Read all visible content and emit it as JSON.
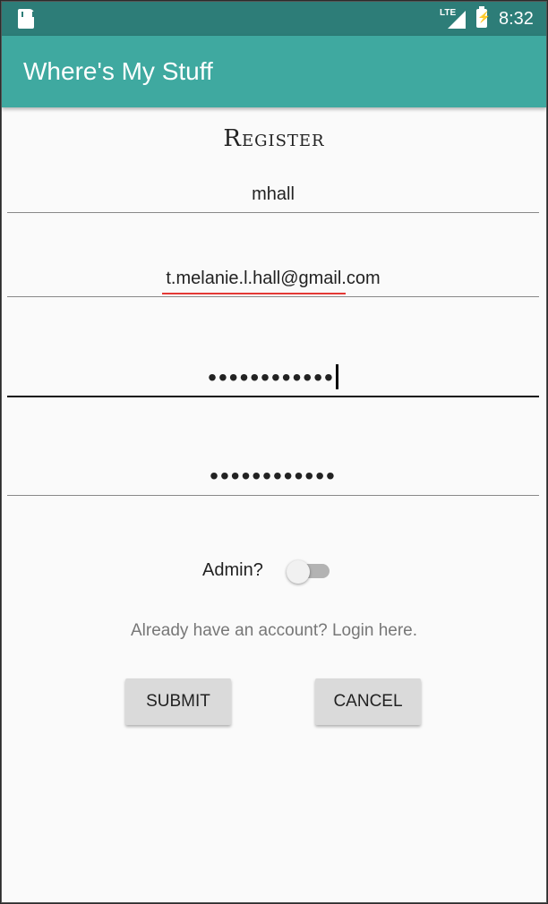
{
  "status_bar": {
    "network": "LTE",
    "time": "8:32"
  },
  "app": {
    "title": "Where's My Stuff",
    "accent": "#3fa9a0"
  },
  "form": {
    "heading": "Register",
    "username": "mhall",
    "email": "t.melanie.l.hall@gmail.com",
    "password": "••••••••••••",
    "confirm_password": "••••••••••••",
    "admin_label": "Admin?",
    "admin_toggle": "off",
    "login_link": "Already have an account? Login here."
  },
  "buttons": {
    "submit": "SUBMIT",
    "cancel": "CANCEL"
  }
}
